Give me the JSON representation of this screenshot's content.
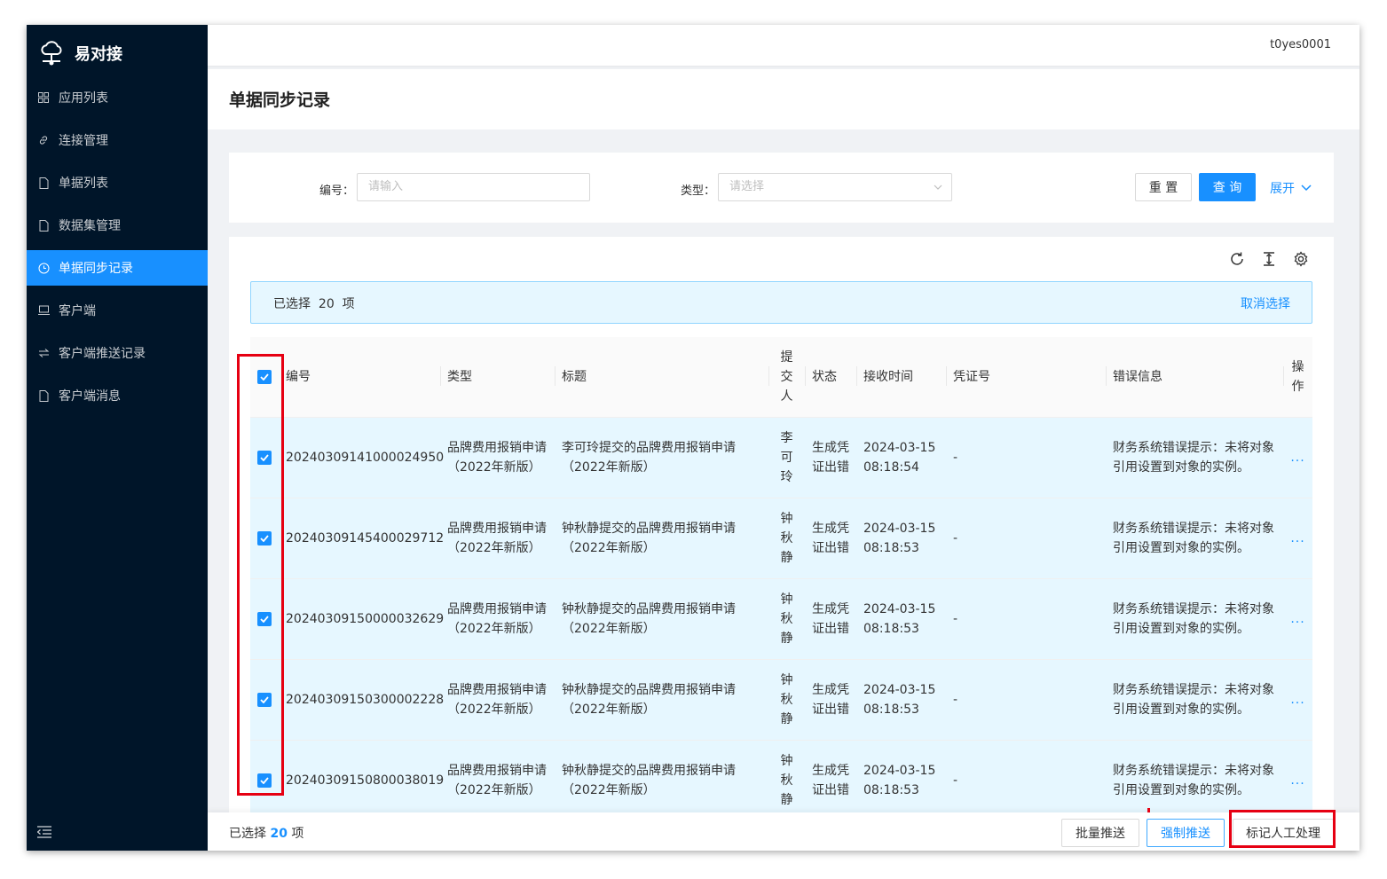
{
  "app": {
    "name": "易对接",
    "logo_icon": "cloud-network-icon"
  },
  "sidebar": {
    "items": [
      {
        "label": "应用列表",
        "icon": "grid-icon",
        "active": false
      },
      {
        "label": "连接管理",
        "icon": "link-icon",
        "active": false
      },
      {
        "label": "单据列表",
        "icon": "file-icon",
        "active": false
      },
      {
        "label": "数据集管理",
        "icon": "file-icon",
        "active": false
      },
      {
        "label": "单据同步记录",
        "icon": "clock-icon",
        "active": true
      },
      {
        "label": "客户端",
        "icon": "laptop-icon",
        "active": false
      },
      {
        "label": "客户端推送记录",
        "icon": "swap-icon",
        "active": false
      },
      {
        "label": "客户端消息",
        "icon": "file-icon",
        "active": false
      }
    ]
  },
  "header": {
    "user": "t0yes0001"
  },
  "page": {
    "title": "单据同步记录"
  },
  "search": {
    "code_label": "编号",
    "code_placeholder": "请输入",
    "type_label": "类型",
    "type_placeholder": "请选择",
    "reset_label": "重 置",
    "query_label": "查 询",
    "expand_label": "展开"
  },
  "selection": {
    "prefix": "已选择",
    "count": "20",
    "suffix": "项",
    "cancel_label": "取消选择"
  },
  "table": {
    "columns": {
      "code": "编号",
      "type": "类型",
      "title": "标题",
      "submitter": "提交人",
      "status": "状态",
      "received": "接收时间",
      "voucher": "凭证号",
      "error": "错误信息",
      "action": "操作"
    },
    "rows": [
      {
        "code": "20240309141000024950",
        "type_a": "品牌费用报销申请",
        "type_b": "（2022年新版）",
        "title_a": "李可玲提交的品牌费用报销申请",
        "title_b": "（2022年新版）",
        "submitter": "李可玲",
        "status_a": "生成凭",
        "status_b": "证出错",
        "date": "2024-03-15",
        "time": "08:18:54",
        "voucher": "-",
        "error_a": "财务系统错误提示：未将对象",
        "error_b": "引用设置到对象的实例。",
        "more": "..."
      },
      {
        "code": "20240309145400029712",
        "type_a": "品牌费用报销申请",
        "type_b": "（2022年新版）",
        "title_a": "钟秋静提交的品牌费用报销申请",
        "title_b": "（2022年新版）",
        "submitter": "钟秋静",
        "status_a": "生成凭",
        "status_b": "证出错",
        "date": "2024-03-15",
        "time": "08:18:53",
        "voucher": "-",
        "error_a": "财务系统错误提示：未将对象",
        "error_b": "引用设置到对象的实例。",
        "more": "..."
      },
      {
        "code": "20240309150000032629",
        "type_a": "品牌费用报销申请",
        "type_b": "（2022年新版）",
        "title_a": "钟秋静提交的品牌费用报销申请",
        "title_b": "（2022年新版）",
        "submitter": "钟秋静",
        "status_a": "生成凭",
        "status_b": "证出错",
        "date": "2024-03-15",
        "time": "08:18:53",
        "voucher": "-",
        "error_a": "财务系统错误提示：未将对象",
        "error_b": "引用设置到对象的实例。",
        "more": "..."
      },
      {
        "code": "20240309150300002228",
        "type_a": "品牌费用报销申请",
        "type_b": "（2022年新版）",
        "title_a": "钟秋静提交的品牌费用报销申请",
        "title_b": "（2022年新版）",
        "submitter": "钟秋静",
        "status_a": "生成凭",
        "status_b": "证出错",
        "date": "2024-03-15",
        "time": "08:18:53",
        "voucher": "-",
        "error_a": "财务系统错误提示：未将对象",
        "error_b": "引用设置到对象的实例。",
        "more": "..."
      },
      {
        "code": "20240309150800038019",
        "type_a": "品牌费用报销申请",
        "type_b": "（2022年新版）",
        "title_a": "钟秋静提交的品牌费用报销申请",
        "title_b": "（2022年新版）",
        "submitter": "钟秋静",
        "status_a": "生成凭",
        "status_b": "证出错",
        "date": "2024-03-15",
        "time": "08:18:53",
        "voucher": "-",
        "error_a": "财务系统错误提示：未将对象",
        "error_b": "引用设置到对象的实例。",
        "more": "..."
      }
    ]
  },
  "footer": {
    "selected_prefix": "已选择",
    "selected_count": "20",
    "selected_suffix": "项",
    "batch_push": "批量推送",
    "force_push": "强制推送",
    "mark_manual": "标记人工处理"
  },
  "colors": {
    "primary": "#1890ff",
    "sidebar": "#001529",
    "highlight": "#e60012"
  }
}
